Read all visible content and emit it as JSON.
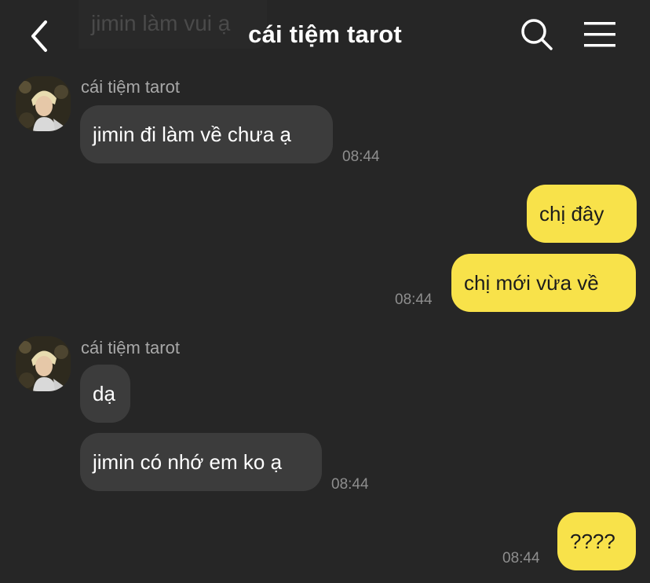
{
  "header": {
    "title": "cái tiệm tarot",
    "ghost_preview": "jimin làm vui ạ"
  },
  "colors": {
    "background": "#262626",
    "incoming_bubble": "#3c3c3c",
    "outgoing_bubble": "#f8e24a",
    "timestamp": "#8e8e8e"
  },
  "messages": {
    "group1": {
      "sender": "cái tiệm tarot",
      "text1": "jimin đi làm về chưa ạ",
      "time": "08:44"
    },
    "group2": {
      "text1": "chị đây",
      "text2": "chị mới vừa về",
      "time": "08:44"
    },
    "group3": {
      "sender": "cái tiệm tarot",
      "text1": "dạ",
      "text2": "jimin có nhớ em ko ạ",
      "time": "08:44"
    },
    "group4": {
      "text1": "????",
      "time": "08:44"
    }
  }
}
